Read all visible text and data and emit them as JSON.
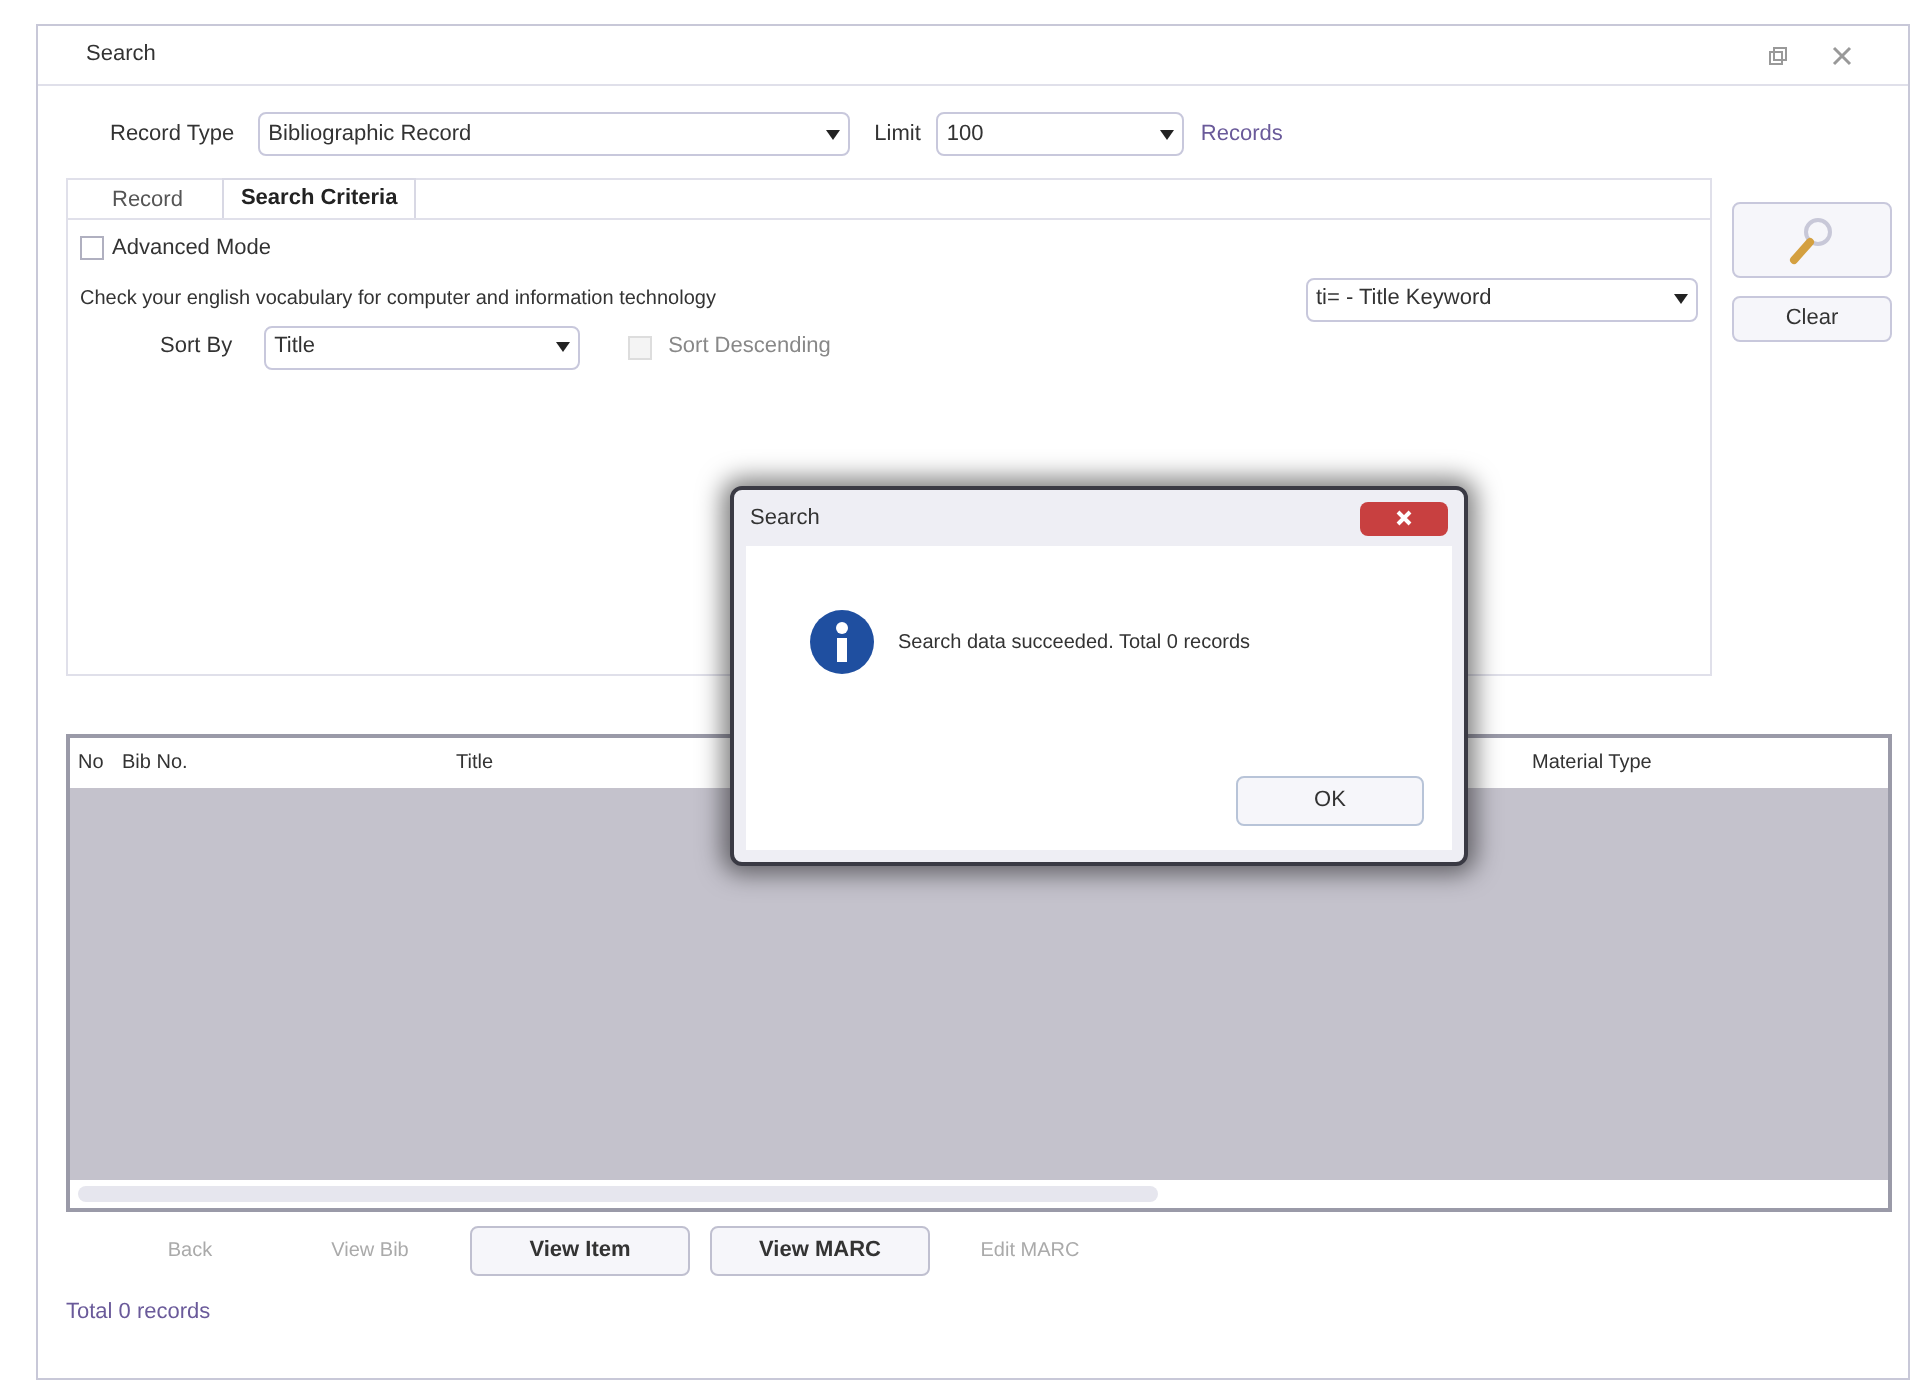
{
  "window": {
    "title": "Search"
  },
  "record_type": {
    "label": "Record Type",
    "value": "Bibliographic Record"
  },
  "limit": {
    "label": "Limit",
    "value": "100",
    "suffix": "Records"
  },
  "tabs": [
    {
      "label": "Record",
      "selected": false
    },
    {
      "label": "Search Criteria",
      "selected": true
    }
  ],
  "advanced_mode": {
    "label": "Advanced Mode",
    "checked": false
  },
  "query": {
    "value": "Check your english vocabulary for computer and information technology"
  },
  "field": {
    "value": "ti= - Title Keyword"
  },
  "sort_by": {
    "label": "Sort By",
    "value": "Title"
  },
  "sort_descending": {
    "label": "Sort Descending",
    "checked": false,
    "disabled": true
  },
  "clear_button": "Clear",
  "table": {
    "columns": [
      {
        "label": "No"
      },
      {
        "label": "Bib No."
      },
      {
        "label": "Title"
      },
      {
        "label": "Material Type"
      }
    ]
  },
  "buttons": [
    {
      "label": "Back",
      "disabled": true
    },
    {
      "label": "View Bib",
      "disabled": true
    },
    {
      "label": "View Item",
      "disabled": false
    },
    {
      "label": "View MARC",
      "disabled": false
    },
    {
      "label": "Edit MARC",
      "disabled": true
    }
  ],
  "status_bar": "Total 0 records",
  "dialog": {
    "title": "Search",
    "message": "Search data succeeded. Total 0 records",
    "ok": "OK"
  }
}
